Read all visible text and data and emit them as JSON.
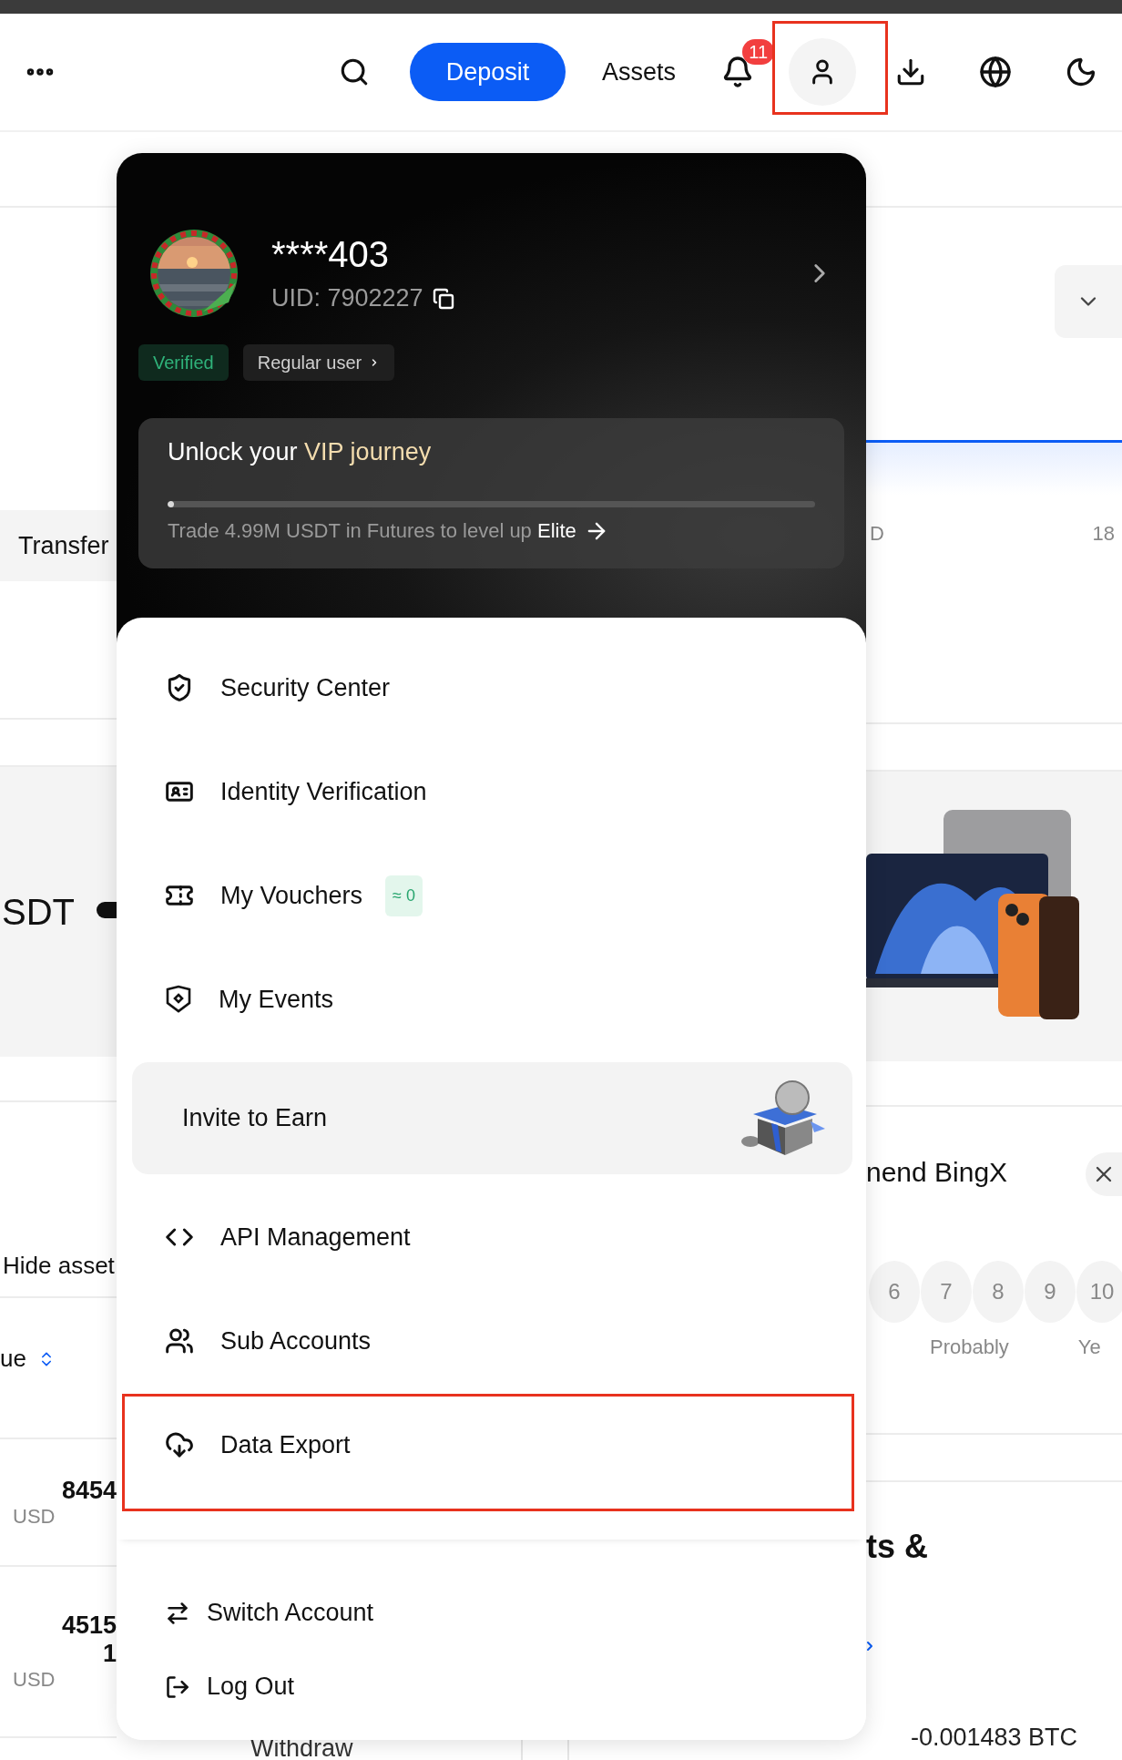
{
  "header": {
    "deposit": "Deposit",
    "assets": "Assets",
    "notification_count": "11",
    "profile_highlighted": true
  },
  "background": {
    "left": {
      "transfer": "Transfer",
      "balance": "SDT",
      "hide_assets": "Hide asset",
      "column_header": "ue",
      "rows": [
        {
          "value_lines": [
            "8454"
          ],
          "usd": "USD"
        },
        {
          "value_lines": [
            "4515",
            "1"
          ],
          "usd": "USD"
        }
      ]
    },
    "right": {
      "column_1": "D",
      "column_2": "18",
      "survey_title": "nend BingX",
      "ratings": [
        "6",
        "7",
        "8",
        "9",
        "10"
      ],
      "rating_labels": [
        "Probably",
        "Ye"
      ],
      "section_title": "ts &",
      "amount": "-0.001483 BTC"
    },
    "withdraw": "Withdraw"
  },
  "profile": {
    "name": "****403",
    "uid": "UID: 7902227",
    "tags": [
      {
        "label": "Verified",
        "kind": "verified"
      },
      {
        "label": "Regular user",
        "kind": "level"
      }
    ],
    "vip": {
      "title_lead": "Unlock your",
      "title_highlight": "VIP journey",
      "level": 0.01,
      "note_lead": "Trade 4.99M USDT in Futures to level up",
      "note_target": "Elite"
    }
  },
  "menu": {
    "items": [
      {
        "label": "Security Center",
        "kind": "item",
        "highlighted": false
      },
      {
        "label": "Identity Verification",
        "kind": "item",
        "highlighted": false
      },
      {
        "label": "My Vouchers",
        "kind": "item",
        "badge": "≈ 0",
        "highlighted": false
      },
      {
        "label": "My Events",
        "kind": "item",
        "highlighted": false
      },
      {
        "label": "Invite to Earn",
        "kind": "promo",
        "highlighted": false
      },
      {
        "label": "API Management",
        "kind": "item",
        "highlighted": false
      },
      {
        "label": "Sub Accounts",
        "kind": "item",
        "highlighted": false
      },
      {
        "label": "Data Export",
        "kind": "item",
        "highlighted": true
      }
    ],
    "footer": [
      "Switch Account",
      "Log Out"
    ]
  }
}
